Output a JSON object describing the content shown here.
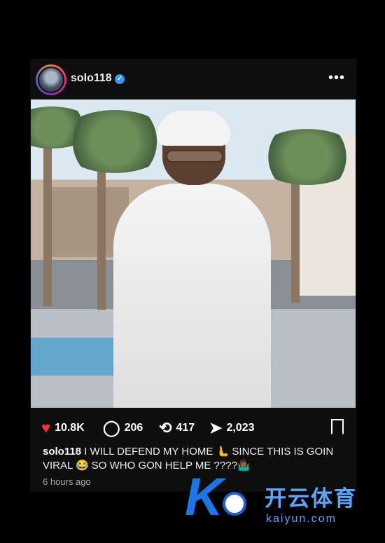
{
  "post": {
    "username": "solo118",
    "verified_icon": "✓",
    "more_icon": "•••",
    "likes": "10.8K",
    "comments": "206",
    "reposts": "417",
    "shares": "2,023",
    "caption_user": "solo118",
    "caption_text": "I WILL DEFEND MY HOME 🫷 SINCE THIS IS GOIN VIRAL 😂 SO WHO GON HELP ME ????🤷🏾‍♂️",
    "time_ago": "6 hours ago"
  },
  "icons": {
    "heart": "heart-icon",
    "comment": "comment-icon",
    "repost": "repost-icon",
    "share": "share-icon",
    "bookmark": "bookmark-icon"
  },
  "colors": {
    "background": "#000000",
    "card": "#0e0e0e",
    "heart": "#ff3040",
    "verified": "#3897f0",
    "watermark": "#5aa6ff"
  },
  "watermark": {
    "chinese": "开云体育",
    "english": "kaiyun.com"
  }
}
